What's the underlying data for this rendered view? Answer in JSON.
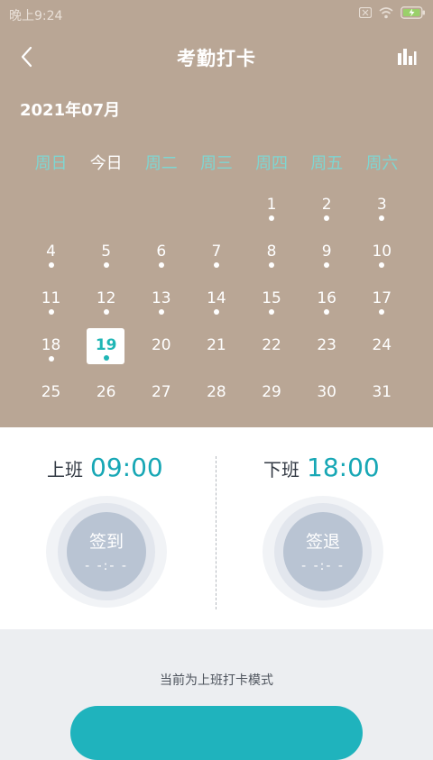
{
  "status_bar": {
    "time": "晚上9:24",
    "icons": [
      "sim-x-icon",
      "wifi-icon",
      "battery-charging-icon"
    ]
  },
  "header": {
    "title": "考勤打卡",
    "back_icon": "chevron-left-icon",
    "stats_icon": "bar-chart-icon"
  },
  "calendar": {
    "month_label": "2021年07月",
    "weekdays": [
      "周日",
      "今日",
      "周二",
      "周三",
      "周四",
      "周五",
      "周六"
    ],
    "today_index": 1,
    "selected_day": 19,
    "rows": [
      [
        {
          "d": ""
        },
        {
          "d": ""
        },
        {
          "d": ""
        },
        {
          "d": ""
        },
        {
          "d": "1",
          "dot": true
        },
        {
          "d": "2",
          "dot": true
        },
        {
          "d": "3",
          "dot": true
        }
      ],
      [
        {
          "d": "4",
          "dot": true
        },
        {
          "d": "5",
          "dot": true
        },
        {
          "d": "6",
          "dot": true
        },
        {
          "d": "7",
          "dot": true
        },
        {
          "d": "8",
          "dot": true
        },
        {
          "d": "9",
          "dot": true
        },
        {
          "d": "10",
          "dot": true
        }
      ],
      [
        {
          "d": "11",
          "dot": true
        },
        {
          "d": "12",
          "dot": true
        },
        {
          "d": "13",
          "dot": true
        },
        {
          "d": "14",
          "dot": true
        },
        {
          "d": "15",
          "dot": true
        },
        {
          "d": "16",
          "dot": true
        },
        {
          "d": "17",
          "dot": true
        }
      ],
      [
        {
          "d": "18",
          "dot": true
        },
        {
          "d": "19",
          "dot": true,
          "selected": true
        },
        {
          "d": "20"
        },
        {
          "d": "21"
        },
        {
          "d": "22"
        },
        {
          "d": "23"
        },
        {
          "d": "24"
        }
      ],
      [
        {
          "d": "25"
        },
        {
          "d": "26"
        },
        {
          "d": "27"
        },
        {
          "d": "28"
        },
        {
          "d": "29"
        },
        {
          "d": "30"
        },
        {
          "d": "31"
        }
      ]
    ]
  },
  "shifts": {
    "on": {
      "label": "上班",
      "time": "09:00",
      "button": "签到",
      "record": "- -:- -"
    },
    "off": {
      "label": "下班",
      "time": "18:00",
      "button": "签退",
      "record": "- -:- -"
    }
  },
  "mode_text": "当前为上班打卡模式",
  "colors": {
    "header_bg": "#b9a695",
    "accent": "#17a7b5",
    "weekday": "#7ed6d2",
    "punch_button": "#b9c4d3"
  }
}
